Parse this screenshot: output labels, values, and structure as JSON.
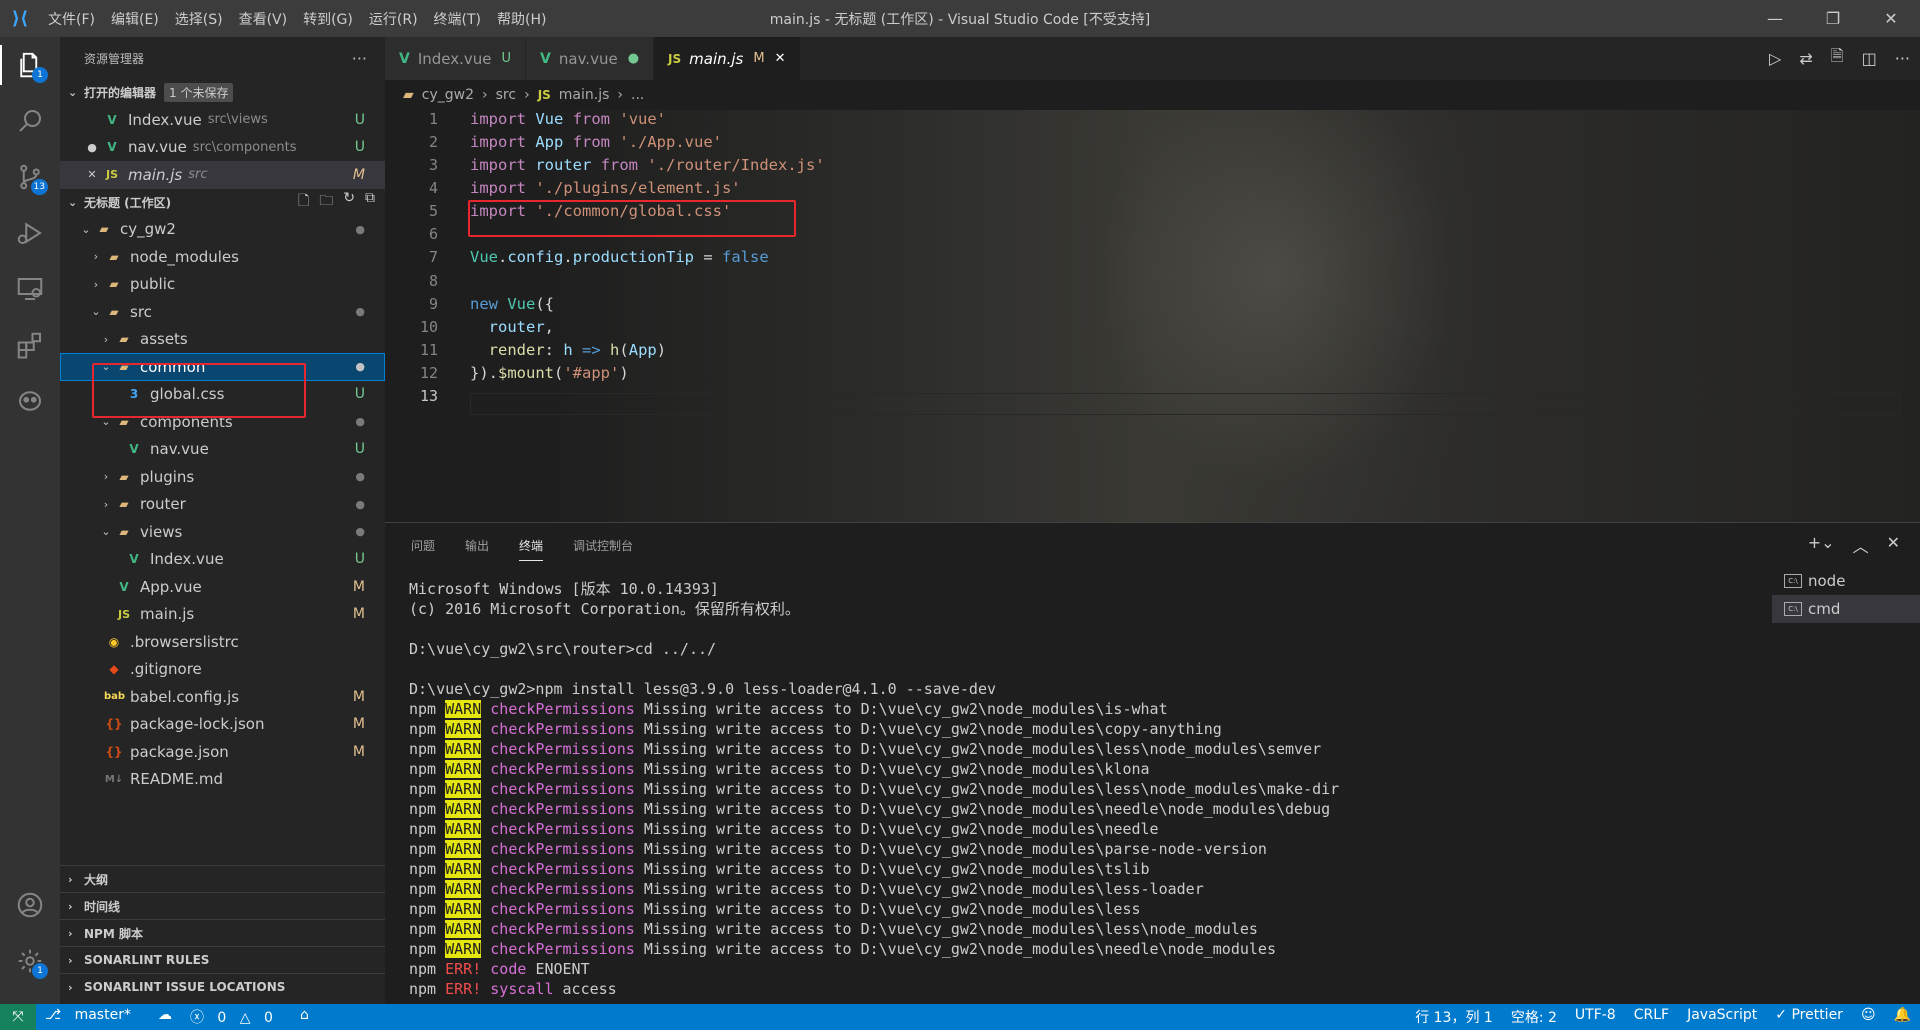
{
  "window": {
    "title": "main.js - 无标题 (工作区) - Visual Studio Code [不受支持]",
    "menu": [
      "文件(F)",
      "编辑(E)",
      "选择(S)",
      "查看(V)",
      "转到(G)",
      "运行(R)",
      "终端(T)",
      "帮助(H)"
    ]
  },
  "activity": {
    "explorer_badge": "1",
    "scm_badge": "13",
    "settings_badge": "1"
  },
  "sidebar": {
    "header": "资源管理器",
    "more": "···",
    "open_editors": {
      "title": "打开的编辑器",
      "unsaved": "1 个未保存",
      "items": [
        {
          "icon": "V",
          "name": "Index.vue",
          "desc": "src\\views",
          "status": "U",
          "prefix": ""
        },
        {
          "icon": "V",
          "name": "nav.vue",
          "desc": "src\\components",
          "status": "U",
          "prefix": "●"
        },
        {
          "icon": "JS",
          "name": "main.js",
          "desc": "src",
          "status": "M",
          "prefix": "✕"
        }
      ]
    },
    "workspace": {
      "title": "无标题 (工作区)",
      "tree": [
        {
          "depth": 0,
          "tw": "⌄",
          "icon": "▰",
          "cls": "folder",
          "name": "cy_gw2",
          "status": "●"
        },
        {
          "depth": 1,
          "tw": "›",
          "icon": "▰",
          "cls": "folder",
          "name": "node_modules",
          "status": ""
        },
        {
          "depth": 1,
          "tw": "›",
          "icon": "▰",
          "cls": "folder",
          "name": "public",
          "status": ""
        },
        {
          "depth": 1,
          "tw": "⌄",
          "icon": "▰",
          "cls": "folder",
          "name": "src",
          "status": "●"
        },
        {
          "depth": 2,
          "tw": "›",
          "icon": "▰",
          "cls": "folder",
          "name": "assets",
          "status": ""
        },
        {
          "depth": 2,
          "tw": "⌄",
          "icon": "▰",
          "cls": "folder",
          "name": "common",
          "status": "●",
          "selected": true
        },
        {
          "depth": 3,
          "tw": "",
          "icon": "3",
          "cls": "css",
          "name": "global.css",
          "status": "U"
        },
        {
          "depth": 2,
          "tw": "⌄",
          "icon": "▰",
          "cls": "folder",
          "name": "components",
          "status": "●"
        },
        {
          "depth": 3,
          "tw": "",
          "icon": "V",
          "cls": "vue",
          "name": "nav.vue",
          "status": "U"
        },
        {
          "depth": 2,
          "tw": "›",
          "icon": "▰",
          "cls": "folder",
          "name": "plugins",
          "status": "●"
        },
        {
          "depth": 2,
          "tw": "›",
          "icon": "▰",
          "cls": "folder",
          "name": "router",
          "status": "●"
        },
        {
          "depth": 2,
          "tw": "⌄",
          "icon": "▰",
          "cls": "folder",
          "name": "views",
          "status": "●"
        },
        {
          "depth": 3,
          "tw": "",
          "icon": "V",
          "cls": "vue",
          "name": "Index.vue",
          "status": "U"
        },
        {
          "depth": 2,
          "tw": "",
          "icon": "V",
          "cls": "vue",
          "name": "App.vue",
          "status": "M"
        },
        {
          "depth": 2,
          "tw": "",
          "icon": "JS",
          "cls": "js",
          "name": "main.js",
          "status": "M"
        },
        {
          "depth": 1,
          "tw": "",
          "icon": "◉",
          "cls": "brow",
          "name": ".browserslistrc",
          "status": ""
        },
        {
          "depth": 1,
          "tw": "",
          "icon": "◆",
          "cls": "git",
          "name": ".gitignore",
          "status": ""
        },
        {
          "depth": 1,
          "tw": "",
          "icon": "bab",
          "cls": "bab",
          "name": "babel.config.js",
          "status": "M"
        },
        {
          "depth": 1,
          "tw": "",
          "icon": "{}",
          "cls": "json",
          "name": "package-lock.json",
          "status": "M"
        },
        {
          "depth": 1,
          "tw": "",
          "icon": "{}",
          "cls": "json",
          "name": "package.json",
          "status": "M"
        },
        {
          "depth": 1,
          "tw": "",
          "icon": "M↓",
          "cls": "md",
          "name": "README.md",
          "status": ""
        }
      ]
    },
    "bottom_sections": [
      "大纲",
      "时间线",
      "NPM 脚本",
      "SONARLINT RULES",
      "SONARLINT ISSUE LOCATIONS"
    ]
  },
  "tabs": [
    {
      "icon": "V",
      "label": "Index.vue",
      "status": "U",
      "active": false
    },
    {
      "icon": "V",
      "label": "nav.vue",
      "status": "●",
      "active": false
    },
    {
      "icon": "JS",
      "label": "main.js",
      "status": "M",
      "close": "✕",
      "active": true
    }
  ],
  "breadcrumb": [
    "cy_gw2",
    "src",
    "main.js",
    "..."
  ],
  "editor": {
    "line_numbers": [
      "1",
      "2",
      "3",
      "4",
      "5",
      "6",
      "7",
      "8",
      "9",
      "10",
      "11",
      "12",
      "13"
    ]
  },
  "panel": {
    "tabs": [
      "问题",
      "输出",
      "终端",
      "调试控制台"
    ],
    "active_tab": "终端",
    "terminals": [
      "node",
      "cmd"
    ],
    "intro": [
      "Microsoft Windows [版本 10.0.14393]",
      "(c) 2016 Microsoft Corporation。保留所有权利。",
      "",
      "D:\\vue\\cy_gw2\\src\\router>cd ../../",
      "",
      "D:\\vue\\cy_gw2>npm install less@3.9.0 less-loader@4.1.0 --save-dev"
    ],
    "warn_paths": [
      "D:\\vue\\cy_gw2\\node_modules\\is-what",
      "D:\\vue\\cy_gw2\\node_modules\\copy-anything",
      "D:\\vue\\cy_gw2\\node_modules\\less\\node_modules\\semver",
      "D:\\vue\\cy_gw2\\node_modules\\klona",
      "D:\\vue\\cy_gw2\\node_modules\\less\\node_modules\\make-dir",
      "D:\\vue\\cy_gw2\\node_modules\\needle\\node_modules\\debug",
      "D:\\vue\\cy_gw2\\node_modules\\needle",
      "D:\\vue\\cy_gw2\\node_modules\\parse-node-version",
      "D:\\vue\\cy_gw2\\node_modules\\tslib",
      "D:\\vue\\cy_gw2\\node_modules\\less-loader",
      "D:\\vue\\cy_gw2\\node_modules\\less",
      "D:\\vue\\cy_gw2\\node_modules\\less\\node_modules",
      "D:\\vue\\cy_gw2\\node_modules\\needle\\node_modules"
    ],
    "warn_text": "Missing write access to",
    "errors": [
      {
        "key": "code",
        "value": "ENOENT"
      },
      {
        "key": "syscall",
        "value": "access"
      }
    ]
  },
  "statusbar": {
    "branch": "master*",
    "errors": "0",
    "warnings": "0",
    "position": "行 13，列 1",
    "spaces": "空格: 2",
    "encoding": "UTF-8",
    "eol": "CRLF",
    "language": "JavaScript",
    "formatter": "✓ Prettier"
  }
}
